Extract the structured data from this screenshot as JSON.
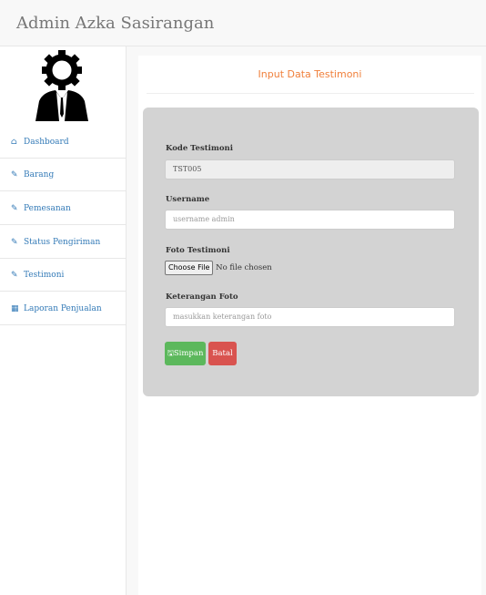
{
  "header": {
    "brand": "Admin Azka Sasirangan"
  },
  "sidebar": {
    "items": [
      {
        "label": "Dashboard",
        "icon": "home-icon",
        "glyph": "⌂"
      },
      {
        "label": "Barang",
        "icon": "edit-icon",
        "glyph": "✎"
      },
      {
        "label": "Pemesanan",
        "icon": "edit-icon",
        "glyph": "✎"
      },
      {
        "label": "Status Pengiriman",
        "icon": "edit-icon",
        "glyph": "✎"
      },
      {
        "label": "Testimoni",
        "icon": "edit-icon",
        "glyph": "✎"
      },
      {
        "label": "Laporan Penjualan",
        "icon": "chart-icon",
        "glyph": "▦"
      }
    ]
  },
  "panel": {
    "title": "Input Data Testimoni"
  },
  "form": {
    "kode_label": "Kode Testimoni",
    "kode_value": "TST005",
    "username_label": "Username",
    "username_placeholder": "username admin",
    "foto_label": "Foto Testimoni",
    "file_button": "Choose File",
    "file_status": "No file chosen",
    "keterangan_label": "Keterangan Foto",
    "keterangan_placeholder": "masukkan keterangan foto",
    "save_label": "Simpan",
    "cancel_label": "Batal"
  },
  "colors": {
    "accent_title": "#f0803c",
    "link": "#337ab7",
    "save": "#5cb85c",
    "cancel": "#d9534f",
    "form_bg": "#d3d3d3"
  }
}
